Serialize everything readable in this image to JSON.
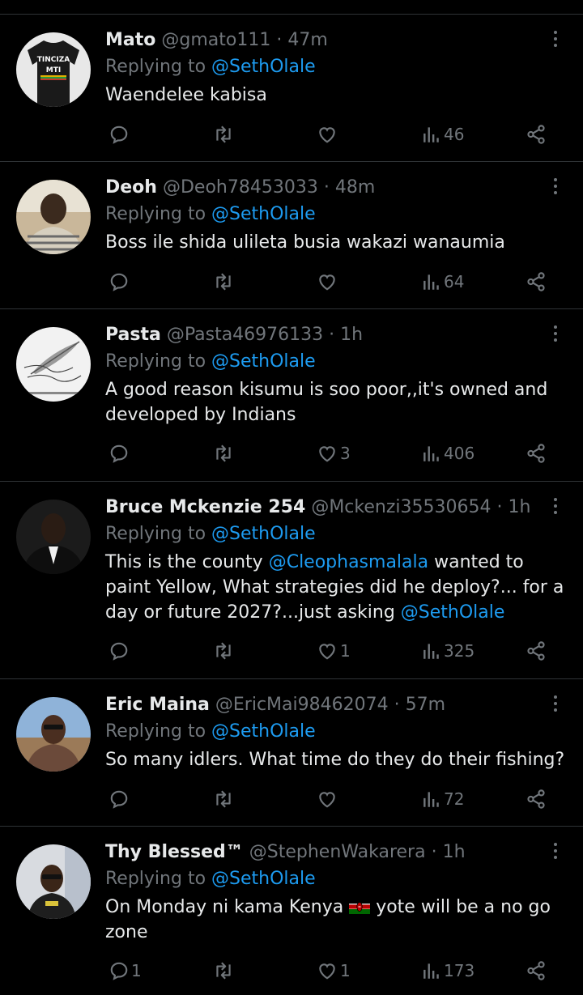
{
  "replying_prefix": "Replying to",
  "replying_handle": "@SethOlale",
  "tweets": [
    {
      "name": "Mato",
      "handle": "@gmato111",
      "sep": "·",
      "time": "47m",
      "text": "Waendelee kabisa",
      "replies": "",
      "likes": "",
      "views": "46",
      "avatar": "black t-shirt with text",
      "avatar_text": [
        "TINCIZA",
        "MTI"
      ]
    },
    {
      "name": "Deoh",
      "handle": "@Deoh78453033",
      "sep": "·",
      "time": "48m",
      "text": "Boss ile shida ulileta busia wakazi wanaumia",
      "replies": "",
      "likes": "",
      "views": "64",
      "avatar": "man in striped shirt"
    },
    {
      "name": "Pasta",
      "handle": "@Pasta46976133",
      "sep": "·",
      "time": "1h",
      "text": "A good reason kisumu is soo poor,,it's owned and developed by Indians",
      "replies": "",
      "likes": "3",
      "views": "406",
      "avatar": "feather quill calligraphy"
    },
    {
      "name": "Bruce Mckenzie 254",
      "handle": "@Mckenzi35530654",
      "sep": "·",
      "time": "1h",
      "text_parts": [
        {
          "t": "This is the county ",
          "m": false
        },
        {
          "t": "@Cleophasmalala",
          "m": true
        },
        {
          "t": " wanted to paint Yellow, What strategies did he deploy?... for a day or future 2027?...just asking ",
          "m": false
        },
        {
          "t": "@SethOlale",
          "m": true
        }
      ],
      "replies": "",
      "likes": "1",
      "views": "325",
      "avatar": "man in suit"
    },
    {
      "name": "Eric Maina",
      "handle": "@EricMai98462074",
      "sep": "·",
      "time": "57m",
      "text": "So many idlers. What time do they do their fishing?",
      "replies": "",
      "likes": "",
      "views": "72",
      "avatar": "man with sunglasses outdoors"
    },
    {
      "name": "Thy Blessed™",
      "handle": "@StephenWakarera",
      "sep": "·",
      "time": "1h",
      "text_before_flag": "On Monday ni kama Kenya ",
      "flag": "kenya-flag",
      "text_after_flag": " yote will be a no go zone",
      "replies": "1",
      "likes": "1",
      "views": "173",
      "avatar": "man with sunglasses indoors"
    }
  ],
  "icons": [
    "reply-icon",
    "retweet-icon",
    "like-icon",
    "views-icon",
    "share-icon",
    "more-icon"
  ],
  "colors": {
    "background": "#000000",
    "text": "#e7e9ea",
    "muted": "#71767b",
    "accent": "#1d9bf0",
    "divider": "#2f3336"
  }
}
